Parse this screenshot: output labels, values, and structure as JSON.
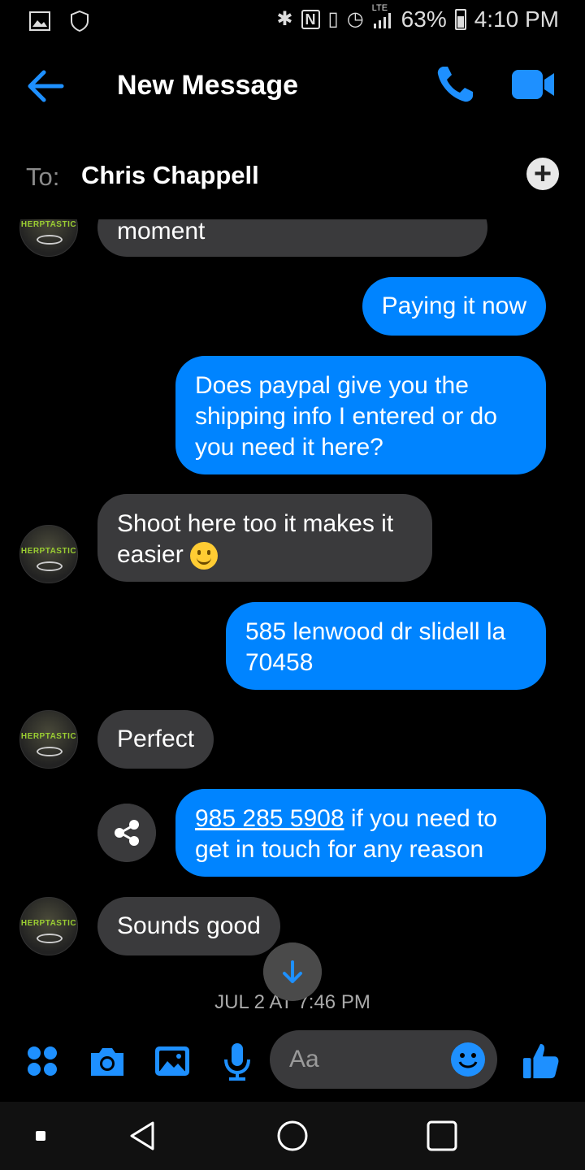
{
  "status_bar": {
    "battery": "63%",
    "time": "4:10 PM",
    "network": "LTE",
    "icons": [
      "gallery-icon",
      "shield-icon",
      "bluetooth-icon",
      "nfc-icon",
      "vibrate-icon",
      "alarm-icon",
      "signal-icon",
      "battery-icon"
    ]
  },
  "header": {
    "title": "New Message",
    "icons": [
      "back-arrow-icon",
      "phone-icon",
      "video-icon"
    ]
  },
  "to_row": {
    "label": "To:",
    "recipient": "Chris Chappell",
    "add_icon": "+"
  },
  "avatar": {
    "logo_text": "HERPTASTIC"
  },
  "messages": [
    {
      "direction": "in",
      "text": "moment"
    },
    {
      "direction": "out",
      "text": "Paying it now"
    },
    {
      "direction": "out",
      "text": "Does paypal give you the shipping info I entered or do you need it here?"
    },
    {
      "direction": "in",
      "text": "Shoot here too it makes it easier",
      "emoji": "slightly-smiling-face"
    },
    {
      "direction": "out",
      "text": "585 lenwood dr slidell la 70458"
    },
    {
      "direction": "in",
      "text": "Perfect"
    },
    {
      "direction": "out",
      "link": "985 285 5908",
      "text": " if you need to get in touch for any reason"
    },
    {
      "direction": "in",
      "text": "Sounds good"
    }
  ],
  "timestamp": "JUL 2 AT 7:46 PM",
  "composer": {
    "placeholder": "Aa",
    "icons": [
      "apps-icon",
      "camera-icon",
      "gallery-icon",
      "microphone-icon",
      "emoji-icon",
      "thumbs-up-icon"
    ]
  },
  "colors": {
    "accent": "#0084ff",
    "incoming_bubble": "#3a3a3c",
    "background": "#000000"
  },
  "navbar": {
    "icons": [
      "recent-apps-icon",
      "back-icon",
      "home-icon",
      "overview-icon"
    ]
  }
}
